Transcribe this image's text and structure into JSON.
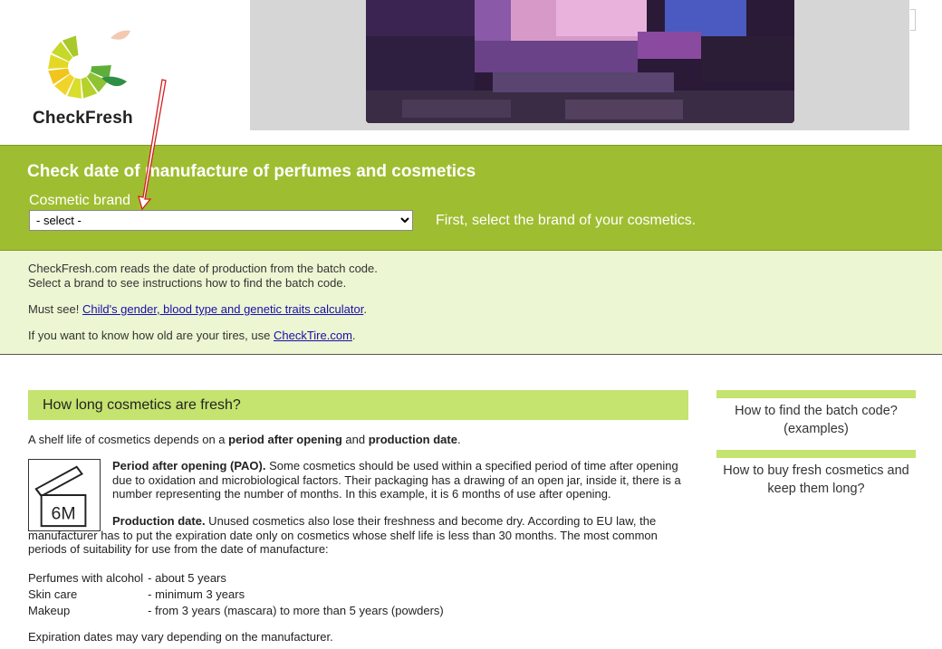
{
  "logo": {
    "text": "CheckFresh"
  },
  "banner": {
    "alt": ""
  },
  "hero": {
    "title": "Check date of manufacture of perfumes and cosmetics",
    "brand_label": "Cosmetic brand",
    "brand_select_value": "- select -",
    "brand_hint": "First, select the brand of your cosmetics."
  },
  "info": {
    "line1": "CheckFresh.com reads the date of production from the batch code.",
    "line2": "Select a brand to see instructions how to find the batch code.",
    "must_see_prefix": "Must see! ",
    "must_see_link": "Child's gender, blood type and genetic traits calculator",
    "must_see_suffix": ".",
    "tires_prefix": "If you want to know how old are your tires, use ",
    "tires_link": "CheckTire.com",
    "tires_suffix": "."
  },
  "article": {
    "title": "How long cosmetics are fresh?",
    "intro_pre": "A shelf life of cosmetics depends on a ",
    "intro_b1": "period after opening",
    "intro_mid": " and ",
    "intro_b2": "production date",
    "intro_post": ".",
    "pao_label": "6M",
    "pao_bold": "Period after opening (PAO).",
    "pao_text": " Some cosmetics should be used within a specified period of time after opening due to oxidation and microbiological factors. Their packaging has a drawing of an open jar, inside it, there is a number representing the number of months. In this example, it is 6 months of use after opening.",
    "prod_bold": "Production date.",
    "prod_text": " Unused cosmetics also lose their freshness and become dry. According to EU law, the manufacturer has to put the expiration date only on cosmetics whose shelf life is less than 30 months. The most common periods of suitability for use from the date of manufacture:",
    "periods": [
      {
        "type": "Perfumes with alcohol",
        "period": "- about 5 years"
      },
      {
        "type": "Skin care",
        "period": "- minimum 3 years"
      },
      {
        "type": "Makeup",
        "period": "- from 3 years (mascara) to more than 5 years (powders)"
      }
    ],
    "footer": "Expiration dates may vary depending on the manufacturer."
  },
  "sidebar": {
    "items": [
      {
        "label": "How to find the batch code? (examples)"
      },
      {
        "label": "How to buy fresh cosmetics and keep them long?"
      }
    ]
  },
  "colors": {
    "hero_green": "#9fbd31",
    "info_bg": "#ecf6d2",
    "title_bar": "#c5e36f",
    "arrow_red": "#d42020"
  }
}
